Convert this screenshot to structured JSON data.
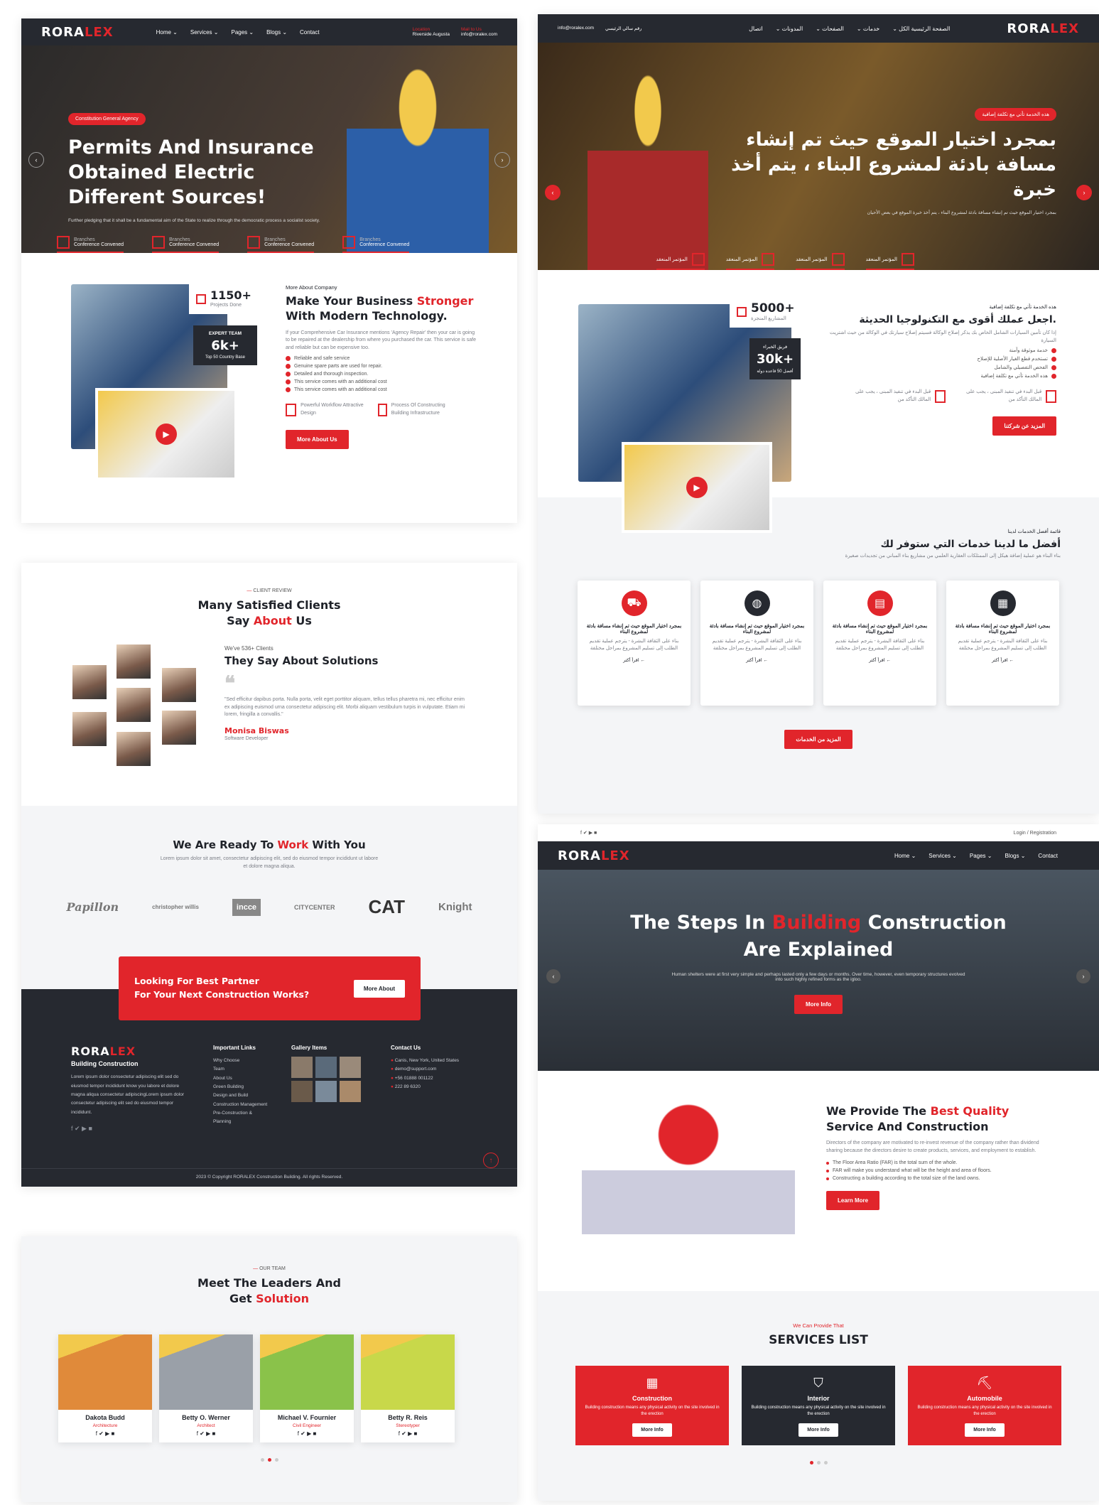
{
  "brand": {
    "logo_a": "RORA",
    "logo_b": "LEX"
  },
  "nav": {
    "home": "Home ⌄",
    "services": "Services ⌄",
    "pages": "Pages ⌄",
    "blogs": "Blogs ⌄",
    "contact": "Contact",
    "loc_label": "Location",
    "loc_value": "Riverside Augusta",
    "mail_label": "Mail to Us",
    "mail_value": "info@roralex.com"
  },
  "hero1": {
    "tag": "Constitution General Agency",
    "line1": "Permits And Insurance",
    "line2": "Obtained Electric",
    "line3": "Different Sources!",
    "desc": "Further pledging that it shall be a fundamental aim of the State to realize through the democratic process a socialist society.",
    "stats": [
      "Conference Convened",
      "Conference Convened",
      "Conference Convened",
      "Conference Convened"
    ],
    "stat_label": "Branches"
  },
  "about": {
    "projects": "1150+",
    "projects_label": "Projects Done",
    "expert": "EXPERT TEAM",
    "expert_n": "6k+",
    "expert_sub": "Top 50 Country Base",
    "kicker": "More About Company",
    "title_a": "Make Your Business ",
    "title_b": "Stronger",
    "title_c": "With Modern Technology.",
    "desc": "If your Comprehensive Car Insurance mentions 'Agency Repair' then your car is going to be repaired at the dealership from where you purchased the car. This service is safe and reliable but can be expensive too.",
    "checks": [
      "Reliable and safe service",
      "Genuine spare parts are used for repair.",
      "Detailed and thorough inspection.",
      "This service comes with an additional cost",
      "This service comes with an additional cost"
    ],
    "f1": "Powerful Workflow Attractive Design",
    "f2": "Process Of Constructing Building Infrastructure",
    "btn": "More About Us"
  },
  "review": {
    "kicker": "CLIENT REVIEW",
    "title_a": "Many Satisfied Clients",
    "title_b": "Say ",
    "title_c": "About",
    "title_d": " Us",
    "clients": "We've 536+ Clients",
    "sub": "They Say About Solutions",
    "quote": "\"Sed efficitur dapibus porta. Nulla porta, velit eget porttitor aliquam, tellus tellus pharetra mi, nec efficitur enim ex adipiscing euismod urna consectetur adipiscing elit. Morbi aliquam vestibulum turpis in vulputate. Etiam mi lorem, fringilla a convallis.\"",
    "name": "Monisa Biswas",
    "role": "Software Developer"
  },
  "partners": {
    "title_a": "We Are Ready To ",
    "title_b": "Work",
    "title_c": " With You",
    "desc": "Lorem ipsum dolor sit amet, consectetur adipiscing elit, sed do eiusmod tempor incididunt ut labore et dolore magna aliqua.",
    "logos": [
      "Papillon",
      "christopher willis",
      "incce",
      "CITYCENTER",
      "CAT",
      "Knight"
    ]
  },
  "cta": {
    "line1": "Looking For Best Partner",
    "line2": "For Your Next Construction Works?",
    "btn": "More About"
  },
  "footer": {
    "tagline": "Building Construction",
    "about": "Lorem ipsum dolor consectetur adipiscing elit sed do eiusmod tempor incididunt know you labore et dolore magna aliqua consectetur adipiscingLorem ipsum dolor consectetur adipiscing elit sed do eiusmod tempor incididunt.",
    "links_h": "Important Links",
    "links": [
      "Why Choose",
      "Team",
      "About Us",
      "Green Building",
      "Design and Build",
      "Construction Management",
      "Pre-Construction & Planning"
    ],
    "gallery_h": "Gallery Items",
    "contact_h": "Contact Us",
    "contact": [
      "Canis, New York, United States",
      "demo@support.com",
      "+56 01888 001122",
      "222 89 6320"
    ],
    "copy": "2023 © Copyright RORALEX Construction Building. All rights Reserved."
  },
  "team": {
    "kicker": "OUR TEAM",
    "title_a": "Meet The Leaders And",
    "title_b": "Get ",
    "title_c": "Solution",
    "members": [
      {
        "name": "Dakota Budd",
        "role": "Architecture"
      },
      {
        "name": "Betty O. Werner",
        "role": "Architect"
      },
      {
        "name": "Michael V. Fournier",
        "role": "Civil Engineer"
      },
      {
        "name": "Betty R. Reis",
        "role": "Stereotyper"
      }
    ]
  },
  "rtl": {
    "nav": [
      "الصفحة الرئيسية الكل ⌄",
      "خدمات ⌄",
      "الصفحات ⌄",
      "المدونات ⌄",
      "اتصال"
    ],
    "loc": "رقم سالي الرئيسي",
    "mail": "info@roralex.com",
    "tag": "هذه الخدمة تأتي مع تكلفة إضافية",
    "h1a": "بمجرد اختيار الموقع حيث تم إنشاء",
    "h1b": "مسافة بادئة لمشروع البناء ، يتم أخذ",
    "h1c": "خبرة",
    "desc": "بمجرد اختيار الموقع حيث تم إنشاء مسافة بادئة لمشروع البناء ، يتم أخذ خبرة الموقع في بعض الأحيان",
    "stat": "المؤتمر المنعقد",
    "projects": "5000+",
    "projects_label": "المشاريع المنجزة",
    "expert": "فريق الخبراء",
    "expert_n": "30k+",
    "expert_sub": "أفضل 50 قاعدة دولة",
    "kicker": "هذه الخدمة تأتي مع تكلفة إضافية",
    "title": ".اجعل عملك أقوى مع التكنولوجيا الحديثة",
    "desc2": "إذا كان تأمين السيارات الشامل الخاص بك يذكر إصلاح الوكالة فسيتم إصلاح سيارتك في الوكالة من حيث اشتريت السيارة",
    "checks": [
      "خدمة موثوقة وآمنة",
      "تستخدم قطع الغيار الأصلية للإصلاح",
      "الفحص التفصيلي والشامل",
      "هذه الخدمة تأتي مع تكلفة إضافية"
    ],
    "f1": "قبل البدء في تنفيذ المبنى ، يجب على المالك التأكد من",
    "f2": "قبل البدء في تنفيذ المبنى ، يجب على المالك التأكد من",
    "btn": "المزيد عن شركتنا",
    "svc_kicker": "قائمة أفضل الخدمات لدينا",
    "svc_title": "أفضل ما لدينا خدمات التي ستوفر لك",
    "svc_desc": "بناء البناء هو عملية إضافة هيكل إلى الممتلكات العقارية العلمي من مشاريع بناء المباني من تجديدات صغيرة",
    "card_title": "بمجرد اختيار الموقع حيث تم إنشاء مسافة بادئة لمشروع البناء",
    "card_desc": "بناء على الثقافة البشرة - يترجم عملية تقديم الطلب إلى تسليم المشروع بمراحل مختلفة",
    "card_link": "← اقرأ أكثر",
    "svc_btn": "المزيد من الخدمات"
  },
  "page3": {
    "login": "Login / Registration",
    "title_a": "The Steps In ",
    "title_b": "Building",
    "title_c": " Construction",
    "title_d": "Are Explained",
    "desc": "Human shelters were at first very simple and perhaps lasted only a few days or months. Over time, however, even temporary structures evolved into such highly refined forms as the igloo.",
    "btn": "More Info",
    "q_a": "We Provide The ",
    "q_b": "Best Quality",
    "q_c": "Service And Construction",
    "q_desc": "Directors of the company are motivated to re-invest revenue of the company rather than dividend sharing because the directors desire to create products, services, and employment to establish.",
    "q_items": [
      "The Floor Area Ratio (FAR) is the total sum of the whole.",
      "FAR will make you understand what will be the height and area of floors.",
      "Constructing a building according to the total size of the land owns."
    ],
    "q_btn": "Learn More",
    "sl_kicker": "We Can Provide That",
    "sl_title": "SERVICES LIST",
    "services": [
      {
        "name": "Construction",
        "desc": "Building construction means any physical activity on the site involved in the erection"
      },
      {
        "name": "Interior",
        "desc": "Building construction means any physical activity on the site involved in the erection"
      },
      {
        "name": "Automobile",
        "desc": "Building construction means any physical activity on the site involved in the erection"
      }
    ],
    "svc_btn": "More Info"
  }
}
